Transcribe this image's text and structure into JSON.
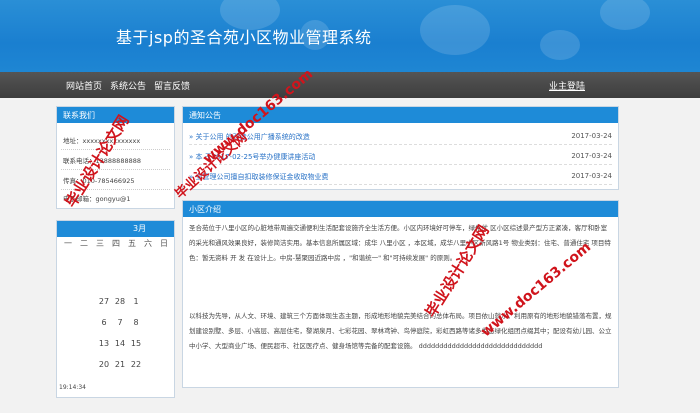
{
  "header": {
    "title": "基于jsp的圣合苑小区物业管理系统"
  },
  "nav": {
    "items": [
      "网站首页",
      "系统公告",
      "留言反馈"
    ],
    "login": "业主登陆"
  },
  "contact": {
    "title": "联系我们",
    "rows": [
      "地址：xxxxxxxxxxxxxxx",
      "联系电话：13888888888",
      "传真：010-785466925",
      "电子邮箱：gongyu@1"
    ]
  },
  "calendar": {
    "month": "3月",
    "weekdays": [
      "一",
      "二",
      "三",
      "四",
      "五",
      "六",
      "日"
    ],
    "cells": [
      "27",
      "28",
      "1",
      "6",
      "7",
      "8",
      "13",
      "14",
      "15",
      "20",
      "21",
      "22"
    ],
    "time": "19:14:34"
  },
  "notice": {
    "title": "通知公告",
    "items": [
      {
        "text": "» 关于公用    的改造公用广播系统的改造",
        "date": "2017-03-24"
      },
      {
        "text": "» 本    于2017-02-25号举办健康讲座活动",
        "date": "2017-03-24"
      },
      {
        "text": "»    业管理公司擅自扣取装修保证金收取物业费",
        "date": "2017-03-24"
      }
    ]
  },
  "intro": {
    "title": "小区介绍",
    "paragraphs": [
      "圣合苑位于八里小区的心脏地带周遍交通便利生活配套设施齐全生活方便。小区内环境好可停车，绿化优 区小区综述景产型方正紧凑，客厅和卧室的采光和通风效果良好，装修简洁实用。基本信息所属区域：成华 八里小区 ，本区域，成华八里小区新风路1号 物业类别：住宅、普通住宅 项目特色：暂无资料 开 发 在设计上。中房-慧聚园近路中房 ，\"和谐统一\" 和\"可持续发展\" 的原则。",
      "以科技为先导，从人文、环境、建筑三个方面体现生态主题，形成地形地貌完美结合的总体布局。项目依山就水，利用原有的地形地貌错落布置，规划建设别墅、多层、小高层、高层住宅，黎湖泉月、七彩花园、翠林鸢钟、鸟停庭院，彩虹西路等诸多生态绿化组团点缀其中；配设有幼儿园、公立中小学、大型商业广场、便民超市、社区医疗点、健身场馆等完备的配套设施。 dddddddddddddddddddddddddddddd"
    ]
  },
  "watermarks": [
    "毕业设计论文网",
    "www.doc163.com",
    "毕业设计论文网",
    "www.doc163.com",
    "毕业设计论文网"
  ],
  "colors": {
    "header_blue": "#1e8bd8",
    "nav_dark": "#3d3d3d",
    "link_blue": "#2a73c7",
    "watermark_red": "#d0141c"
  }
}
